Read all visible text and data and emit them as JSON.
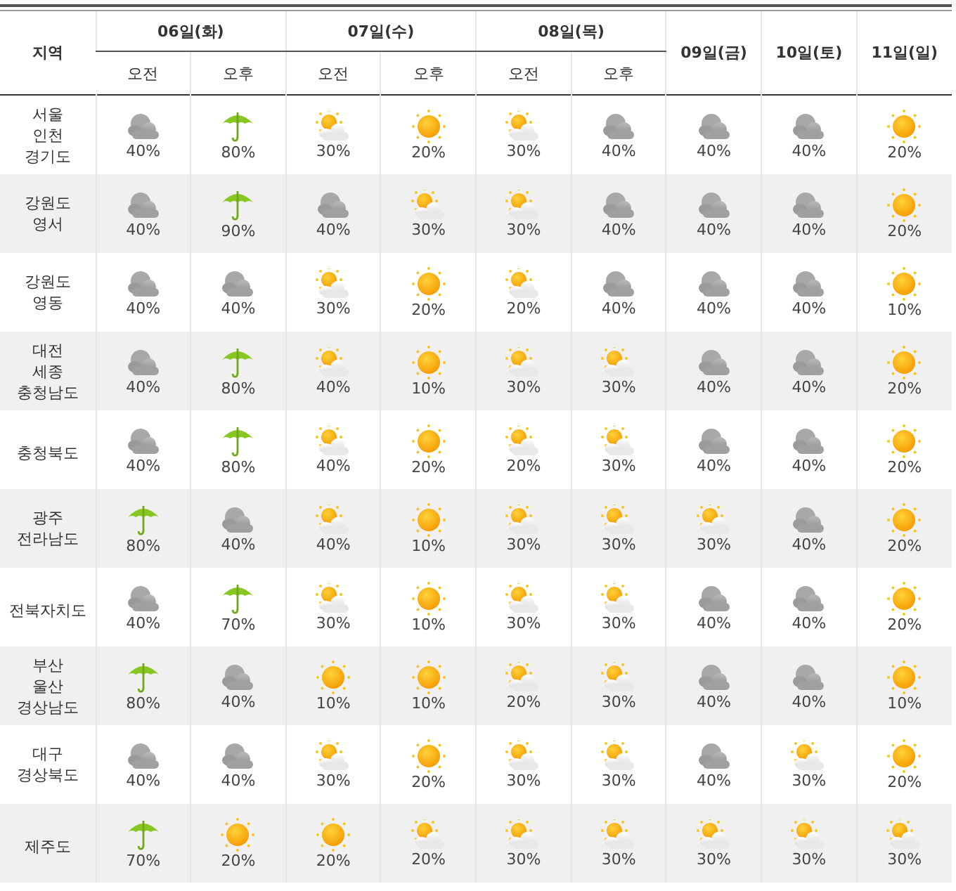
{
  "header": {
    "region_label": "지역",
    "days": [
      {
        "label": "06일(화)",
        "periods": [
          "오전",
          "오후"
        ]
      },
      {
        "label": "07일(수)",
        "periods": [
          "오전",
          "오후"
        ]
      },
      {
        "label": "08일(목)",
        "periods": [
          "오전",
          "오후"
        ]
      },
      {
        "label": "09일(금)"
      },
      {
        "label": "10일(토)"
      },
      {
        "label": "11일(일)"
      }
    ]
  },
  "rows": [
    {
      "region": "서울\n인천\n경기도",
      "cells": [
        {
          "kind": "cloud",
          "value": "40%"
        },
        {
          "kind": "rain",
          "value": "80%"
        },
        {
          "kind": "partly",
          "value": "30%"
        },
        {
          "kind": "sun",
          "value": "20%"
        },
        {
          "kind": "partly",
          "value": "30%"
        },
        {
          "kind": "cloud",
          "value": "40%"
        },
        {
          "kind": "cloud",
          "value": "40%"
        },
        {
          "kind": "cloud",
          "value": "40%"
        },
        {
          "kind": "sun",
          "value": "20%"
        }
      ]
    },
    {
      "region": "강원도\n영서",
      "cells": [
        {
          "kind": "cloud",
          "value": "40%"
        },
        {
          "kind": "rain",
          "value": "90%"
        },
        {
          "kind": "cloud",
          "value": "40%"
        },
        {
          "kind": "partly",
          "value": "30%"
        },
        {
          "kind": "partly",
          "value": "30%"
        },
        {
          "kind": "cloud",
          "value": "40%"
        },
        {
          "kind": "cloud",
          "value": "40%"
        },
        {
          "kind": "cloud",
          "value": "40%"
        },
        {
          "kind": "sun",
          "value": "20%"
        }
      ]
    },
    {
      "region": "강원도\n영동",
      "cells": [
        {
          "kind": "cloud",
          "value": "40%"
        },
        {
          "kind": "cloud",
          "value": "40%"
        },
        {
          "kind": "partly",
          "value": "30%"
        },
        {
          "kind": "sun",
          "value": "20%"
        },
        {
          "kind": "partly",
          "value": "20%"
        },
        {
          "kind": "cloud",
          "value": "40%"
        },
        {
          "kind": "cloud",
          "value": "40%"
        },
        {
          "kind": "cloud",
          "value": "40%"
        },
        {
          "kind": "sun",
          "value": "10%"
        }
      ]
    },
    {
      "region": "대전\n세종\n충청남도",
      "cells": [
        {
          "kind": "cloud",
          "value": "40%"
        },
        {
          "kind": "rain",
          "value": "80%"
        },
        {
          "kind": "partly",
          "value": "40%"
        },
        {
          "kind": "sun",
          "value": "10%"
        },
        {
          "kind": "partly",
          "value": "30%"
        },
        {
          "kind": "partly",
          "value": "30%"
        },
        {
          "kind": "cloud",
          "value": "40%"
        },
        {
          "kind": "cloud",
          "value": "40%"
        },
        {
          "kind": "sun",
          "value": "20%"
        }
      ]
    },
    {
      "region": "충청북도",
      "cells": [
        {
          "kind": "cloud",
          "value": "40%"
        },
        {
          "kind": "rain",
          "value": "80%"
        },
        {
          "kind": "partly",
          "value": "40%"
        },
        {
          "kind": "sun",
          "value": "20%"
        },
        {
          "kind": "partly",
          "value": "20%"
        },
        {
          "kind": "partly",
          "value": "30%"
        },
        {
          "kind": "cloud",
          "value": "40%"
        },
        {
          "kind": "cloud",
          "value": "40%"
        },
        {
          "kind": "sun",
          "value": "20%"
        }
      ]
    },
    {
      "region": "광주\n전라남도",
      "cells": [
        {
          "kind": "rain",
          "value": "80%"
        },
        {
          "kind": "cloud",
          "value": "40%"
        },
        {
          "kind": "partly",
          "value": "40%"
        },
        {
          "kind": "sun",
          "value": "10%"
        },
        {
          "kind": "partly",
          "value": "30%"
        },
        {
          "kind": "partly",
          "value": "30%"
        },
        {
          "kind": "partly",
          "value": "30%"
        },
        {
          "kind": "cloud",
          "value": "40%"
        },
        {
          "kind": "sun",
          "value": "20%"
        }
      ]
    },
    {
      "region": "전북자치도",
      "cells": [
        {
          "kind": "cloud",
          "value": "40%"
        },
        {
          "kind": "rain",
          "value": "70%"
        },
        {
          "kind": "partly",
          "value": "30%"
        },
        {
          "kind": "sun",
          "value": "10%"
        },
        {
          "kind": "partly",
          "value": "30%"
        },
        {
          "kind": "partly",
          "value": "30%"
        },
        {
          "kind": "cloud",
          "value": "40%"
        },
        {
          "kind": "cloud",
          "value": "40%"
        },
        {
          "kind": "sun",
          "value": "20%"
        }
      ]
    },
    {
      "region": "부산\n울산\n경상남도",
      "cells": [
        {
          "kind": "rain",
          "value": "80%"
        },
        {
          "kind": "cloud",
          "value": "40%"
        },
        {
          "kind": "sun",
          "value": "10%"
        },
        {
          "kind": "sun",
          "value": "10%"
        },
        {
          "kind": "partly",
          "value": "20%"
        },
        {
          "kind": "partly",
          "value": "30%"
        },
        {
          "kind": "cloud",
          "value": "40%"
        },
        {
          "kind": "cloud",
          "value": "40%"
        },
        {
          "kind": "sun",
          "value": "10%"
        }
      ]
    },
    {
      "region": "대구\n경상북도",
      "cells": [
        {
          "kind": "cloud",
          "value": "40%"
        },
        {
          "kind": "cloud",
          "value": "40%"
        },
        {
          "kind": "partly",
          "value": "30%"
        },
        {
          "kind": "sun",
          "value": "20%"
        },
        {
          "kind": "partly",
          "value": "30%"
        },
        {
          "kind": "partly",
          "value": "30%"
        },
        {
          "kind": "cloud",
          "value": "40%"
        },
        {
          "kind": "partly",
          "value": "30%"
        },
        {
          "kind": "sun",
          "value": "20%"
        }
      ]
    },
    {
      "region": "제주도",
      "cells": [
        {
          "kind": "rain",
          "value": "70%"
        },
        {
          "kind": "sun",
          "value": "20%"
        },
        {
          "kind": "sun",
          "value": "20%"
        },
        {
          "kind": "partly",
          "value": "20%"
        },
        {
          "kind": "partly",
          "value": "30%"
        },
        {
          "kind": "partly",
          "value": "30%"
        },
        {
          "kind": "partly",
          "value": "30%"
        },
        {
          "kind": "partly",
          "value": "30%"
        },
        {
          "kind": "partly",
          "value": "30%"
        }
      ]
    }
  ]
}
